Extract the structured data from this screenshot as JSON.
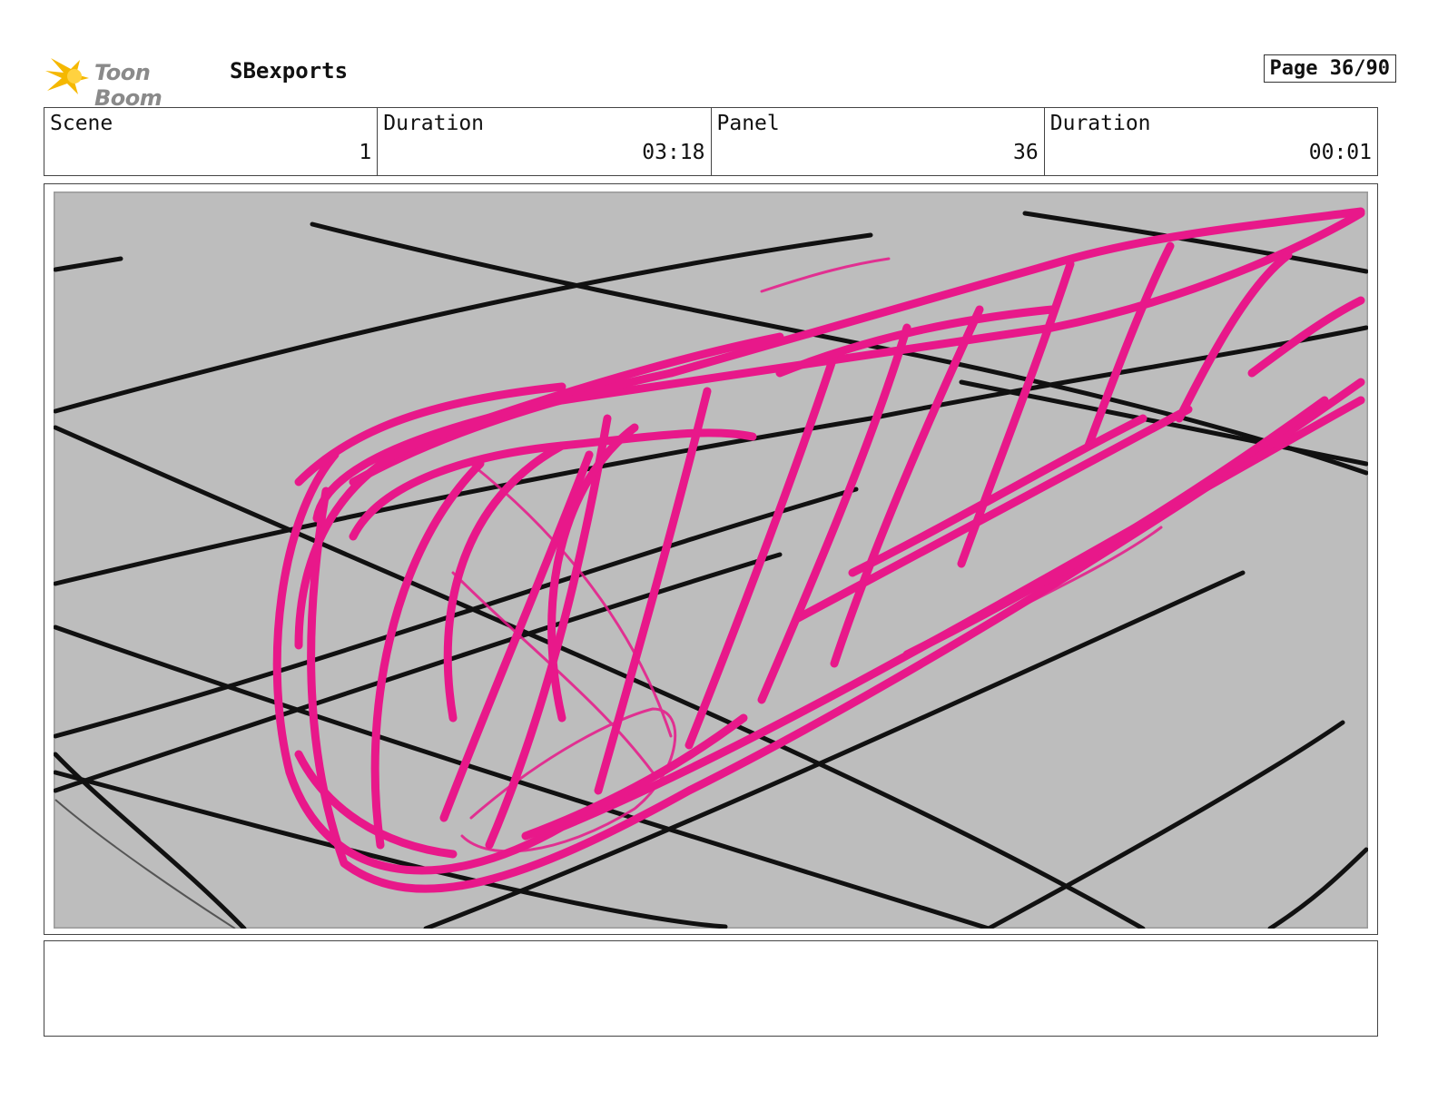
{
  "header": {
    "logo_text": "Toon Boom",
    "project": "SBexports",
    "page": "Page 36/90"
  },
  "info": [
    {
      "label": "Scene",
      "value": "1"
    },
    {
      "label": "Duration",
      "value": "03:18"
    },
    {
      "label": "Panel",
      "value": "36"
    },
    {
      "label": "Duration",
      "value": "00:01"
    }
  ],
  "colors": {
    "canvas_bg": "#bdbdbd",
    "grid_line": "#111111",
    "sketch": "#e8188a",
    "logo_star": "#f5b800"
  },
  "notes": ""
}
